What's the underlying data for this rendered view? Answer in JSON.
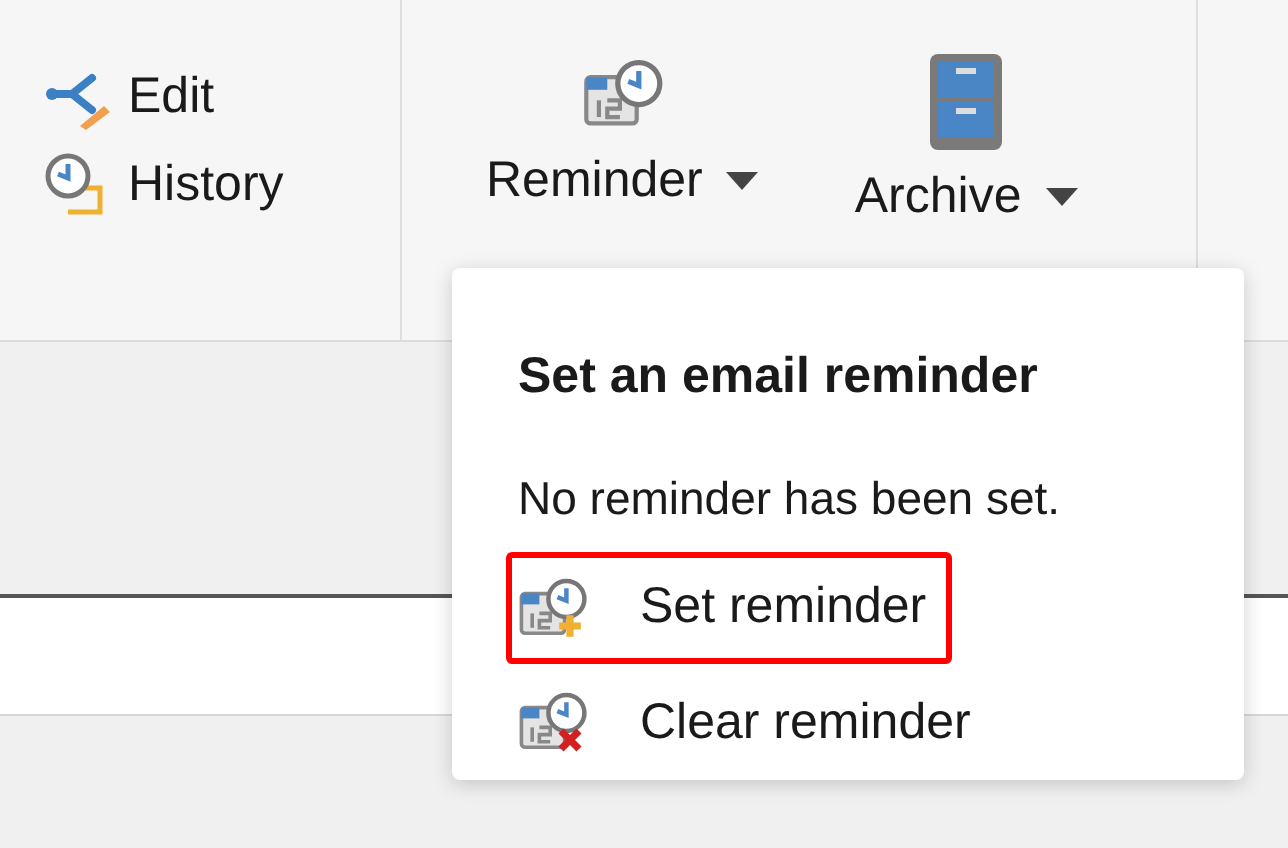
{
  "ribbon": {
    "small_buttons": [
      {
        "label": "Edit"
      },
      {
        "label": "History"
      }
    ],
    "menu_buttons": [
      {
        "label": "Reminder"
      },
      {
        "label": "Archive"
      }
    ]
  },
  "dropdown": {
    "title": "Set an email reminder",
    "status": "No reminder has been set.",
    "items": [
      {
        "label": "Set reminder",
        "highlighted": true
      },
      {
        "label": "Clear reminder",
        "highlighted": false
      }
    ]
  }
}
